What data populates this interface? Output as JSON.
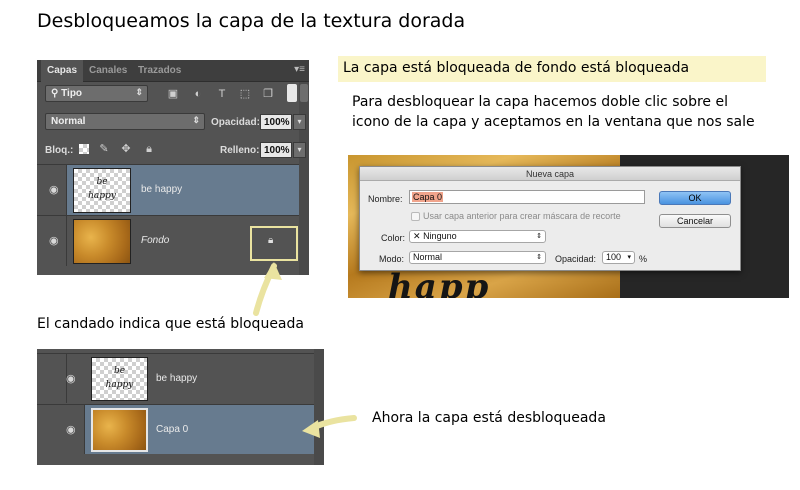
{
  "title": "Desbloqueamos la capa de la textura dorada",
  "panel1": {
    "tabs": [
      "Capas",
      "Canales",
      "Trazados"
    ],
    "filter_label": "Tipo",
    "blend_mode": "Normal",
    "opacity_label": "Opacidad:",
    "opacity_value": "100%",
    "lock_label": "Bloq.:",
    "fill_label": "Relleno:",
    "fill_value": "100%",
    "layers": [
      {
        "name": "be happy",
        "thumb_text_1": "be",
        "thumb_text_2": "happy"
      },
      {
        "name": "Fondo"
      }
    ]
  },
  "note": "La capa está bloqueada de fondo está bloqueada",
  "instructions": "Para desbloquear la capa hacemos doble clic sobre el icono de la capa y aceptamos en la ventana que nos sale",
  "dialog": {
    "title": "Nueva capa",
    "name_label": "Nombre:",
    "name_value": "Capa 0",
    "checkbox_label": "Usar capa anterior para crear máscara de recorte",
    "color_label": "Color:",
    "color_value": "Ninguno",
    "mode_label": "Modo:",
    "mode_value": "Normal",
    "opacity_label": "Opacidad:",
    "opacity_value": "100",
    "percent": "%",
    "ok": "OK",
    "cancel": "Cancelar",
    "bg_text": "happ"
  },
  "caption_lock": "El candado indica que está bloqueada",
  "panel2": {
    "layers": [
      {
        "name": "be happy",
        "thumb_text_1": "be",
        "thumb_text_2": "happy"
      },
      {
        "name": "Capa 0"
      }
    ]
  },
  "caption_unlocked": "Ahora la capa está desbloqueada",
  "colors": {
    "highlight": "#faf5c9",
    "selected_layer": "#677b8f",
    "panel_bg": "#535353",
    "ok_button": "#4a93e0"
  }
}
